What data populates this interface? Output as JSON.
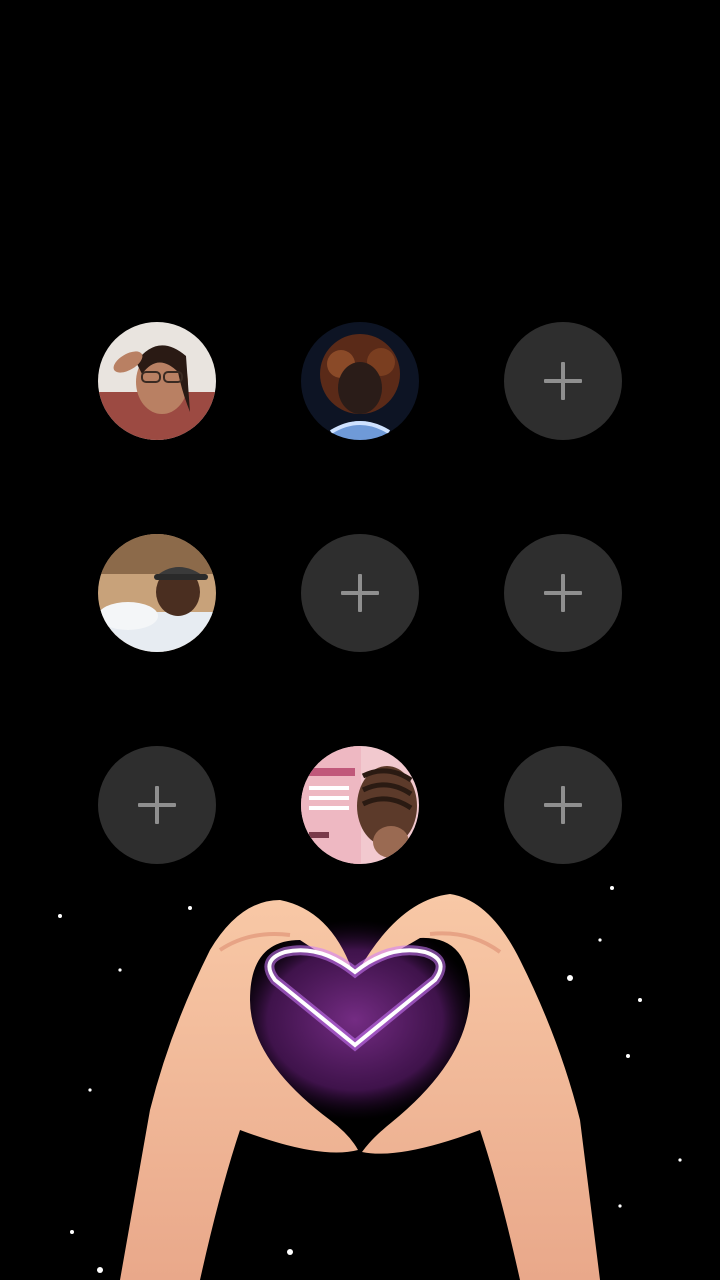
{
  "screen": {
    "background": "#000000"
  },
  "grid": {
    "slots": [
      {
        "state": "filled",
        "avatar": "avatar-1"
      },
      {
        "state": "filled",
        "avatar": "avatar-2"
      },
      {
        "state": "empty",
        "icon": "plus-icon"
      },
      {
        "state": "filled",
        "avatar": "avatar-3"
      },
      {
        "state": "empty",
        "icon": "plus-icon"
      },
      {
        "state": "empty",
        "icon": "plus-icon"
      },
      {
        "state": "empty",
        "icon": "plus-icon"
      },
      {
        "state": "filled",
        "avatar": "avatar-4"
      },
      {
        "state": "empty",
        "icon": "plus-icon"
      }
    ],
    "empty_slot_color": "#2e2e2e",
    "plus_color": "#8f8f8f"
  },
  "decoration": {
    "icon": "heart-hands",
    "glow_color": "#c77dff"
  }
}
